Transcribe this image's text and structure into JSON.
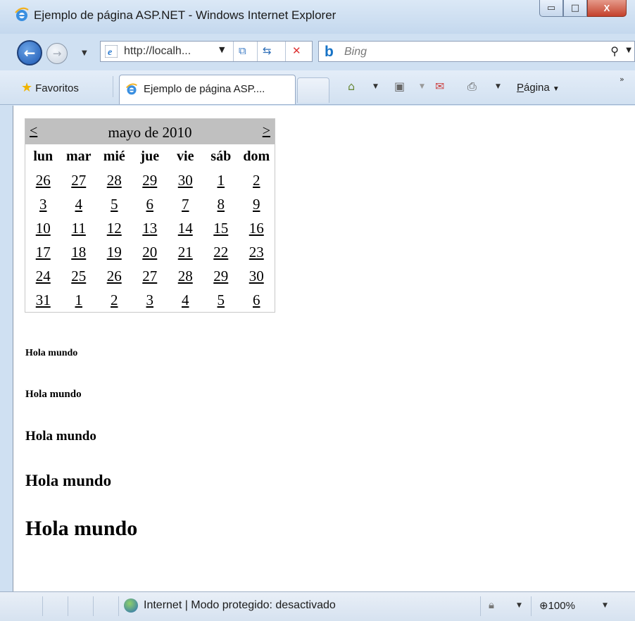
{
  "window": {
    "title": "Ejemplo de página ASP.NET - Windows Internet Explorer",
    "buttons": {
      "minimize": "▭",
      "maximize": "□",
      "close": "X"
    }
  },
  "nav": {
    "url": "http://localh...",
    "search_placeholder": "Bing",
    "search_logo": "b"
  },
  "commandbar": {
    "favorites_label": "Favoritos",
    "tab_label": "Ejemplo de página ASP....",
    "page_menu_label": "Página",
    "page_menu_accesskey": "P",
    "page_menu_rest": "ágina",
    "more": "»"
  },
  "calendar": {
    "prev": "<",
    "next": ">",
    "title": "mayo de 2010",
    "day_headers": [
      "lun",
      "mar",
      "mié",
      "jue",
      "vie",
      "sáb",
      "dom"
    ],
    "weeks": [
      [
        "26",
        "27",
        "28",
        "29",
        "30",
        "1",
        "2"
      ],
      [
        "3",
        "4",
        "5",
        "6",
        "7",
        "8",
        "9"
      ],
      [
        "10",
        "11",
        "12",
        "13",
        "14",
        "15",
        "16"
      ],
      [
        "17",
        "18",
        "19",
        "20",
        "21",
        "22",
        "23"
      ],
      [
        "24",
        "25",
        "26",
        "27",
        "28",
        "29",
        "30"
      ],
      [
        "31",
        "1",
        "2",
        "3",
        "4",
        "5",
        "6"
      ]
    ]
  },
  "headings": [
    "Hola mundo",
    "Hola mundo",
    "Hola mundo",
    "Hola mundo",
    "Hola mundo"
  ],
  "status": {
    "zone_text": "Internet | Modo protegido: desactivado",
    "zoom": "100%"
  }
}
